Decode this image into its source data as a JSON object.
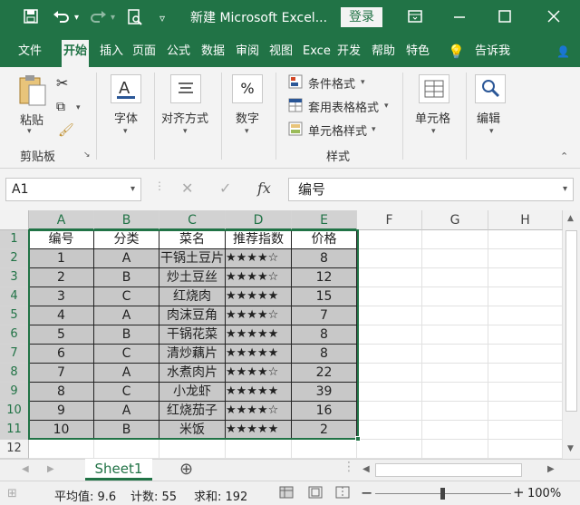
{
  "titlebar": {
    "title": "新建 Microsoft Excel...",
    "login": "登录",
    "icons": [
      "save-icon",
      "undo-icon",
      "redo-icon",
      "print-preview-icon",
      "customize-qat-icon",
      "ribbon-display-icon",
      "minimize-icon",
      "maximize-icon",
      "close-icon"
    ]
  },
  "tabs": [
    "文件",
    "开始",
    "插入",
    "页面",
    "公式",
    "数据",
    "审阅",
    "视图",
    "Exce",
    "开发",
    "帮助",
    "特色",
    "告诉我"
  ],
  "ribbon": {
    "clipboard": {
      "paste": "粘贴",
      "group": "剪贴板"
    },
    "font": "字体",
    "align": "对齐方式",
    "number": "数字",
    "styles": {
      "cond": "条件格式",
      "table": "套用表格格式",
      "cell": "单元格样式",
      "group": "样式"
    },
    "cells": "单元格",
    "edit": "编辑",
    "percent": "%"
  },
  "formula_bar": {
    "name_box": "A1",
    "fx": "fx",
    "content": "编号"
  },
  "columns": [
    "A",
    "B",
    "C",
    "D",
    "E",
    "F",
    "G",
    "H"
  ],
  "rows": [
    "1",
    "2",
    "3",
    "4",
    "5",
    "6",
    "7",
    "8",
    "9",
    "10",
    "11",
    "12"
  ],
  "table": {
    "header": [
      "编号",
      "分类",
      "菜名",
      "推荐指数",
      "价格"
    ],
    "rows": [
      [
        "1",
        "A",
        "干锅土豆片",
        "★★★★☆",
        "8"
      ],
      [
        "2",
        "B",
        "炒土豆丝",
        "★★★★☆",
        "12"
      ],
      [
        "3",
        "C",
        "红烧肉",
        "★★★★★",
        "15"
      ],
      [
        "4",
        "A",
        "肉沫豆角",
        "★★★★☆",
        "7"
      ],
      [
        "5",
        "B",
        "干锅花菜",
        "★★★★★",
        "8"
      ],
      [
        "6",
        "C",
        "清炒藕片",
        "★★★★★",
        "8"
      ],
      [
        "7",
        "A",
        "水煮肉片",
        "★★★★☆",
        "22"
      ],
      [
        "8",
        "C",
        "小龙虾",
        "★★★★★",
        "39"
      ],
      [
        "9",
        "A",
        "红烧茄子",
        "★★★★☆",
        "16"
      ],
      [
        "10",
        "B",
        "米饭",
        "★★★★★",
        "2"
      ]
    ]
  },
  "sheet": {
    "name": "Sheet1",
    "add": "⊕"
  },
  "status": {
    "average": "平均值: 9.6",
    "count": "计数: 55",
    "sum": "求和: 192",
    "zoom": "100%",
    "minus": "−",
    "plus": "+"
  }
}
